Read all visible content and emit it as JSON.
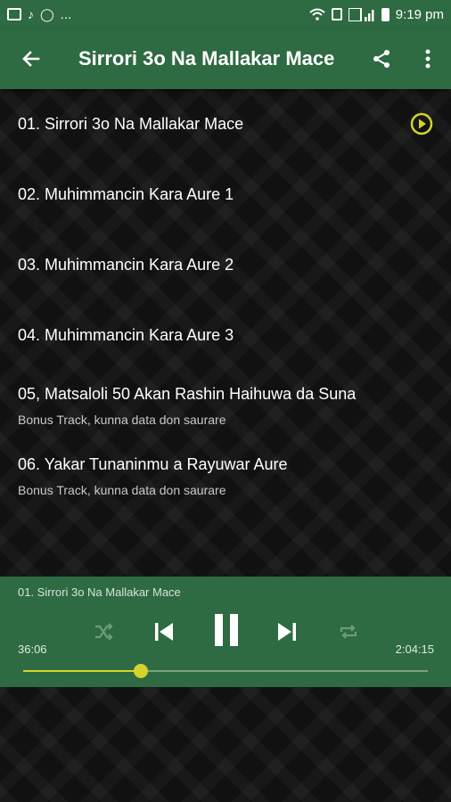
{
  "status_bar": {
    "left_extra": "...",
    "time": "9:19 pm",
    "icons": [
      "image-icon",
      "music-note-icon",
      "whatsapp-icon",
      "wifi-icon",
      "sim-icon",
      "signal-icon",
      "battery-icon"
    ]
  },
  "app_bar": {
    "title": "Sirrori 3o Na Mallakar Mace",
    "back_icon": "arrow-left-icon",
    "share_icon": "share-icon",
    "more_icon": "more-vertical-icon"
  },
  "tracks": [
    {
      "title": "01. Sirrori 3o Na Mallakar Mace",
      "subtitle": "",
      "playing": true
    },
    {
      "title": "02. Muhimmancin Kara Aure 1",
      "subtitle": ""
    },
    {
      "title": "03. Muhimmancin Kara Aure 2",
      "subtitle": ""
    },
    {
      "title": "04. Muhimmancin Kara Aure 3",
      "subtitle": ""
    },
    {
      "title": "05, Matsaloli 50 Akan Rashin Haihuwa da Suna",
      "subtitle": "Bonus Track, kunna data don saurare"
    },
    {
      "title": "06. Yakar Tunaninmu a Rayuwar Aure",
      "subtitle": "Bonus Track, kunna data don saurare"
    }
  ],
  "player": {
    "now_playing": "01. Sirrori 3o Na Mallakar Mace",
    "elapsed": "36:06",
    "duration": "2:04:15",
    "progress": 0.29
  },
  "colors": {
    "primary": "#2e6a42",
    "accent": "#d4d32b"
  }
}
